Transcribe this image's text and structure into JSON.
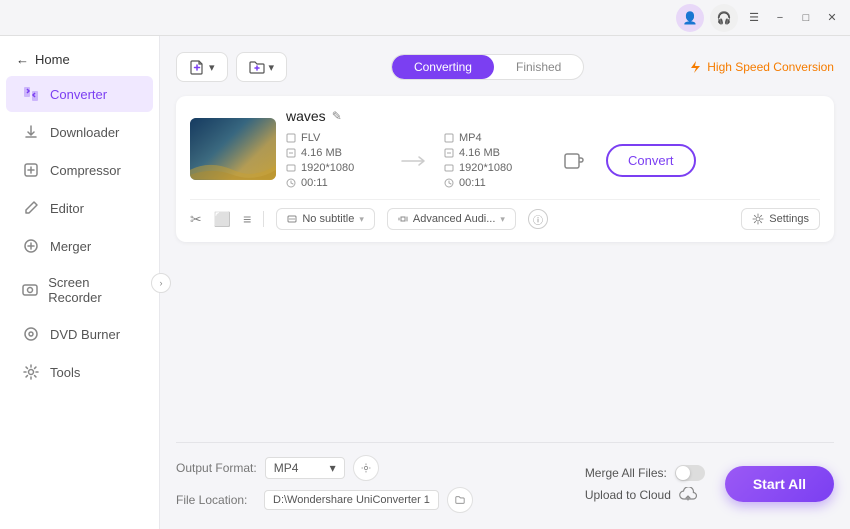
{
  "titlebar": {
    "user_icon": "👤",
    "support_icon": "🎧",
    "menu_icon": "☰",
    "minimize_label": "−",
    "maximize_label": "□",
    "close_label": "✕"
  },
  "sidebar": {
    "back_label": "Home",
    "items": [
      {
        "id": "converter",
        "label": "Converter",
        "icon": "⇄",
        "active": true
      },
      {
        "id": "downloader",
        "label": "Downloader",
        "icon": "↓"
      },
      {
        "id": "compressor",
        "label": "Compressor",
        "icon": "⊡"
      },
      {
        "id": "editor",
        "label": "Editor",
        "icon": "✏"
      },
      {
        "id": "merger",
        "label": "Merger",
        "icon": "⊕"
      },
      {
        "id": "screen-recorder",
        "label": "Screen Recorder",
        "icon": "⊙"
      },
      {
        "id": "dvd-burner",
        "label": "DVD Burner",
        "icon": "◎"
      },
      {
        "id": "tools",
        "label": "Tools",
        "icon": "⚙"
      }
    ]
  },
  "toolbar": {
    "add_file_label": "Add Files",
    "add_folder_label": "",
    "tab_converting": "Converting",
    "tab_finished": "Finished",
    "high_speed_label": "High Speed Conversion"
  },
  "file_card": {
    "filename": "waves",
    "source": {
      "format": "FLV",
      "resolution": "1920*1080",
      "size": "4.16 MB",
      "duration": "00:11"
    },
    "output": {
      "format": "MP4",
      "resolution": "1920*1080",
      "size": "4.16 MB",
      "duration": "00:11"
    },
    "convert_label": "Convert",
    "subtitle_label": "No subtitle",
    "audio_label": "Advanced Audi...",
    "settings_label": "Settings"
  },
  "bottom_bar": {
    "output_format_label": "Output Format:",
    "output_format_value": "MP4",
    "file_location_label": "File Location:",
    "file_location_value": "D:\\Wondershare UniConverter 1",
    "merge_all_label": "Merge All Files:",
    "upload_cloud_label": "Upload to Cloud",
    "start_all_label": "Start All"
  }
}
